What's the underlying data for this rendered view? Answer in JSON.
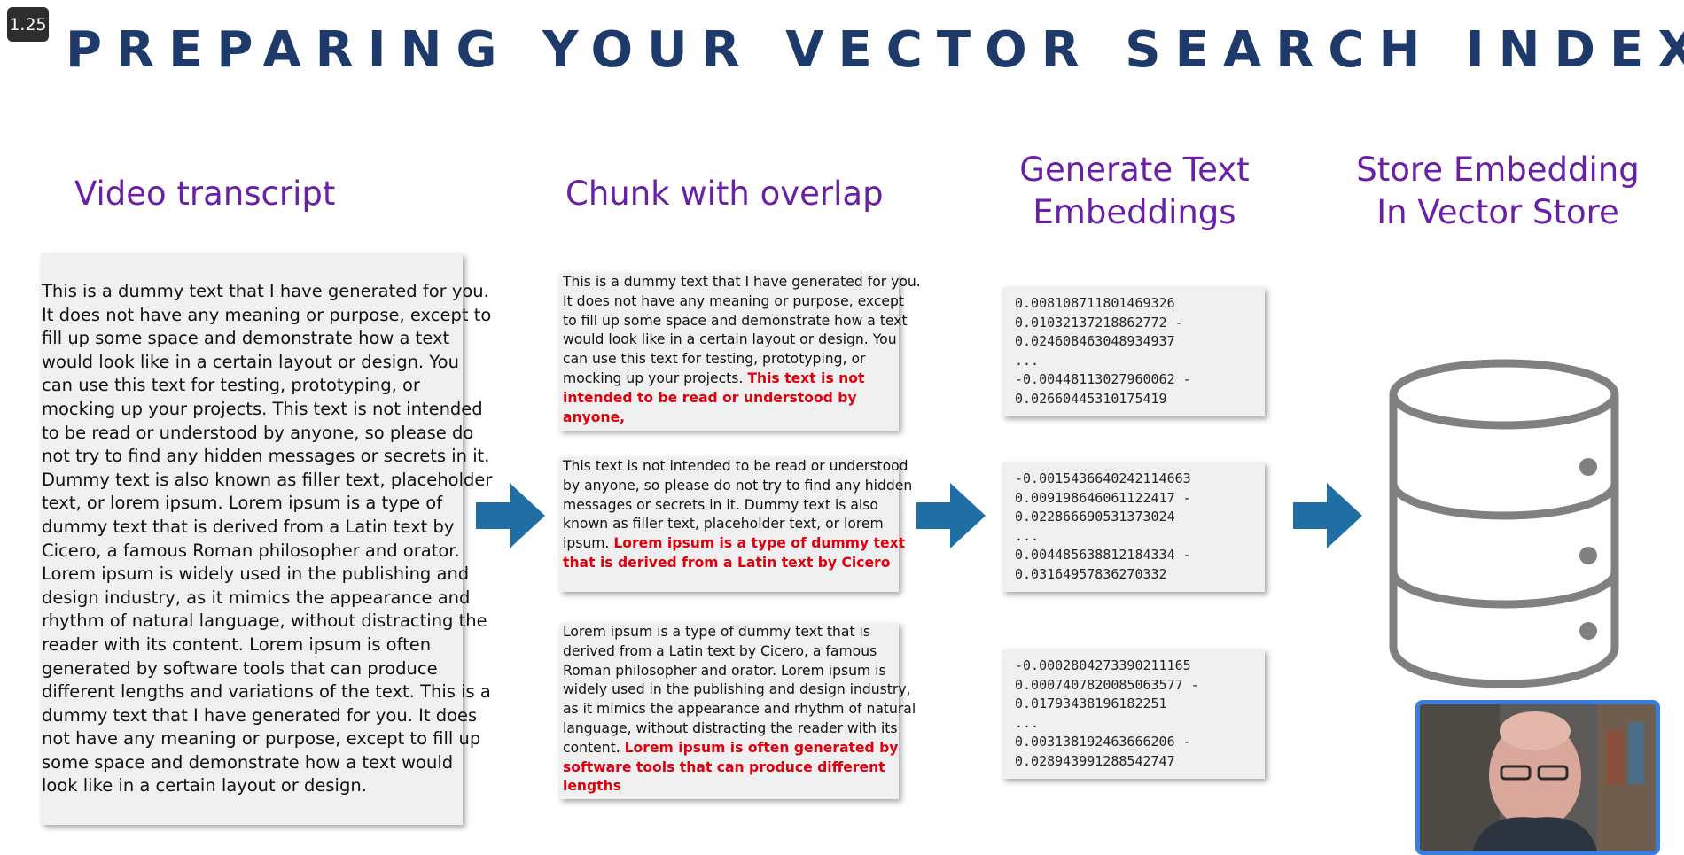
{
  "playback": {
    "speed": "1.25"
  },
  "slide": {
    "title": "PREPARING YOUR VECTOR SEARCH INDEX",
    "columns": {
      "transcript_heading": "Video transcript",
      "chunk_heading": "Chunk with overlap",
      "embed_heading_line1": "Generate Text",
      "embed_heading_line2": "Embeddings",
      "store_heading_line1": "Store Embedding",
      "store_heading_line2": "In Vector Store"
    },
    "transcript_lines": [
      "This is a dummy text that I have generated for you.",
      "It does not have any meaning or purpose, except to",
      "fill up some space and demonstrate how a text",
      "would look like in a certain layout or design. You",
      "can use this text for testing, prototyping, or",
      "mocking up your projects. This text is not intended",
      "to be read or understood by anyone, so please do",
      "not try to find any hidden messages or secrets in it.",
      "Dummy text is also known as filler text, placeholder",
      "text, or lorem ipsum. Lorem ipsum is a type of",
      "dummy text that is derived from a Latin text by",
      "Cicero, a famous Roman philosopher and orator.",
      "Lorem ipsum is widely used in the publishing and",
      "design industry, as it mimics the appearance and",
      "rhythm of natural language, without distracting the",
      "reader with its content. Lorem ipsum is often",
      "generated by software tools that can produce",
      "different lengths and variations of the text. This is a",
      "dummy text that I have generated for you. It does",
      "not have any meaning or purpose, except to fill up",
      "some space and demonstrate how a text would",
      "look like in a certain layout or design."
    ],
    "chunks": [
      {
        "lines": [
          [
            {
              "t": "This is a dummy text that I have generated for you.",
              "hl": false
            }
          ],
          [
            {
              "t": "It does not have any meaning or purpose, except",
              "hl": false
            }
          ],
          [
            {
              "t": "to fill up some space and demonstrate how a text",
              "hl": false
            }
          ],
          [
            {
              "t": "would look like in a certain layout or design. You",
              "hl": false
            }
          ],
          [
            {
              "t": "can use this text for testing, prototyping, or",
              "hl": false
            }
          ],
          [
            {
              "t": "mocking up your projects. ",
              "hl": false
            },
            {
              "t": "This text is not",
              "hl": true
            }
          ],
          [
            {
              "t": "intended to be read or understood by",
              "hl": true
            }
          ],
          [
            {
              "t": "anyone,",
              "hl": true
            }
          ]
        ]
      },
      {
        "lines": [
          [
            {
              "t": "This text is not intended to be read or understood",
              "hl": false
            }
          ],
          [
            {
              "t": "by anyone, so please do not try to find any hidden",
              "hl": false
            }
          ],
          [
            {
              "t": "messages or secrets in it. Dummy text is also",
              "hl": false
            }
          ],
          [
            {
              "t": "known as filler text, placeholder text, or lorem",
              "hl": false
            }
          ],
          [
            {
              "t": "ipsum. ",
              "hl": false
            },
            {
              "t": "Lorem ipsum is a type of dummy text",
              "hl": true
            }
          ],
          [
            {
              "t": "that is derived from a Latin text by Cicero",
              "hl": true
            }
          ]
        ]
      },
      {
        "lines": [
          [
            {
              "t": "Lorem ipsum is a type of dummy text that is",
              "hl": false
            }
          ],
          [
            {
              "t": "derived from a Latin text by Cicero, a famous",
              "hl": false
            }
          ],
          [
            {
              "t": "Roman philosopher and orator. Lorem ipsum is",
              "hl": false
            }
          ],
          [
            {
              "t": "widely used in the publishing and design industry,",
              "hl": false
            }
          ],
          [
            {
              "t": "as it mimics the appearance and rhythm of natural",
              "hl": false
            }
          ],
          [
            {
              "t": "language, without distracting the reader with its",
              "hl": false
            }
          ],
          [
            {
              "t": "content. ",
              "hl": false
            },
            {
              "t": "Lorem ipsum is often generated by",
              "hl": true
            }
          ],
          [
            {
              "t": "software tools that can produce different",
              "hl": true
            }
          ],
          [
            {
              "t": "lengths",
              "hl": true
            }
          ]
        ]
      }
    ],
    "embeddings": [
      [
        "0.008108711801469326",
        "0.01032137218862772 -",
        "0.024608463048934937",
        "...",
        "-0.00448113027960062 -",
        "0.02660445310175419"
      ],
      [
        "-0.0015436640242114663",
        "0.009198646061122417 -",
        "0.022866690531373024",
        "...",
        "0.004485638812184334 -",
        "0.03164957836270332"
      ],
      [
        "-0.0002804273390211165",
        "0.0007407820085063577 -",
        "0.01793438196182251",
        "...",
        "0.003138192463666206 -",
        "0.028943991288542747"
      ]
    ],
    "colors": {
      "title": "#1e3a6b",
      "heading": "#6a1fa8",
      "arrow": "#1f6fa5",
      "highlight": "#e0000d",
      "database": "#808080",
      "webcam_border": "#3a7fe0"
    },
    "icons": [
      "right-arrow-icon",
      "database-icon"
    ]
  }
}
